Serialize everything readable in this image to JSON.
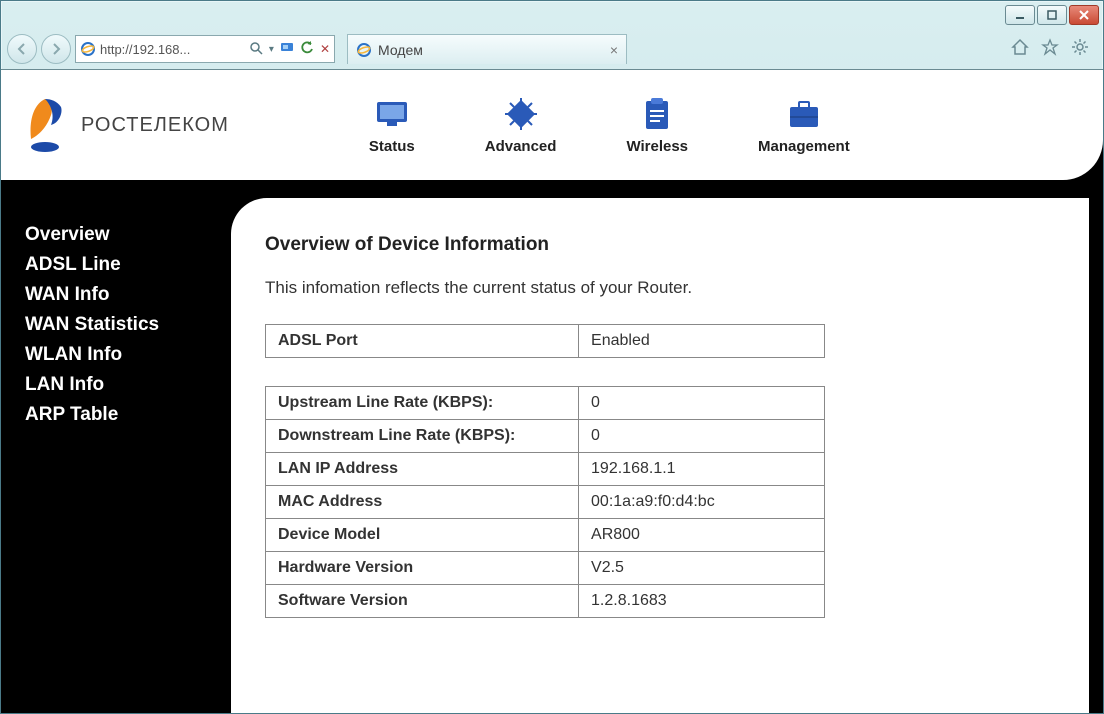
{
  "browser": {
    "url_display": "http://192.168...",
    "tab_title": "Модем"
  },
  "brand": "РОСТЕЛЕКОМ",
  "top_nav": [
    {
      "label": "Status"
    },
    {
      "label": "Advanced"
    },
    {
      "label": "Wireless"
    },
    {
      "label": "Management"
    }
  ],
  "sidebar": [
    "Overview",
    "ADSL Line",
    "WAN Info",
    "WAN Statistics",
    "WLAN Info",
    "LAN Info",
    "ARP Table"
  ],
  "main": {
    "heading": "Overview of Device Information",
    "subtext": "This infomation reflects the current status of your Router.",
    "port_table": [
      {
        "label": "ADSL Port",
        "value": "Enabled"
      }
    ],
    "info_table": [
      {
        "label": "Upstream Line Rate (KBPS):",
        "value": "0"
      },
      {
        "label": "Downstream Line Rate (KBPS):",
        "value": "0"
      },
      {
        "label": "LAN IP Address",
        "value": "192.168.1.1"
      },
      {
        "label": "MAC Address",
        "value": "00:1a:a9:f0:d4:bc"
      },
      {
        "label": "Device Model",
        "value": "AR800"
      },
      {
        "label": "Hardware Version",
        "value": "V2.5"
      },
      {
        "label": "Software Version",
        "value": "1.2.8.1683"
      }
    ]
  }
}
